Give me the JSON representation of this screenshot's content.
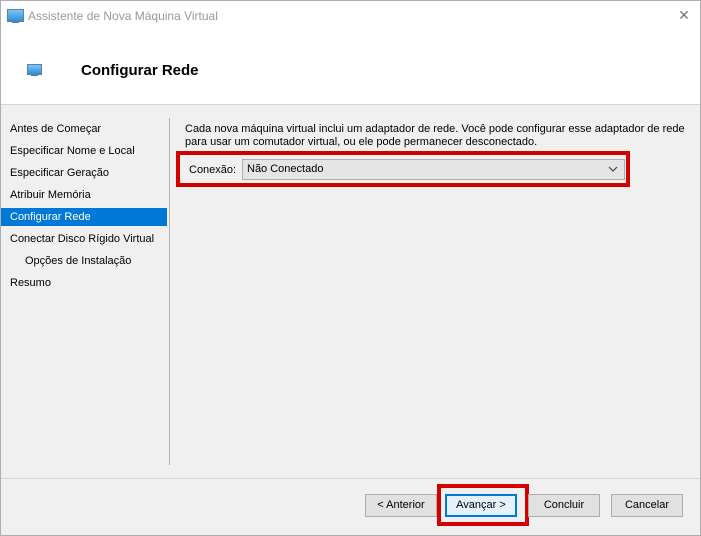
{
  "window": {
    "title": "Assistente de Nova Máquina Virtual",
    "close_glyph": "✕"
  },
  "header": {
    "title": "Configurar Rede"
  },
  "sidebar": {
    "items": [
      {
        "label": "Antes de Começar",
        "active": false,
        "sub": false
      },
      {
        "label": "Especificar Nome e Local",
        "active": false,
        "sub": false
      },
      {
        "label": "Especificar Geração",
        "active": false,
        "sub": false
      },
      {
        "label": "Atribuir Memória",
        "active": false,
        "sub": false
      },
      {
        "label": "Configurar Rede",
        "active": true,
        "sub": false
      },
      {
        "label": "Conectar Disco Rígido Virtual",
        "active": false,
        "sub": false
      },
      {
        "label": "Opções de Instalação",
        "active": false,
        "sub": true
      },
      {
        "label": "Resumo",
        "active": false,
        "sub": false
      }
    ]
  },
  "main": {
    "description_line1": "Cada nova máquina virtual inclui um adaptador de rede. Você pode configurar esse adaptador de rede",
    "description_line2": "para usar um comutador virtual, ou ele pode permanecer desconectado.",
    "connection_label": "Conexão:",
    "connection_value": "Não Conectado"
  },
  "buttons": {
    "previous": "< Anterior",
    "next": "Avançar >",
    "finish": "Concluir",
    "cancel": "Cancelar"
  },
  "colors": {
    "accent": "#0078d7",
    "highlight": "#d40000"
  },
  "icons": {
    "app": "virtual-machine-icon",
    "close": "close-icon",
    "dropdown": "chevron-down-icon"
  }
}
